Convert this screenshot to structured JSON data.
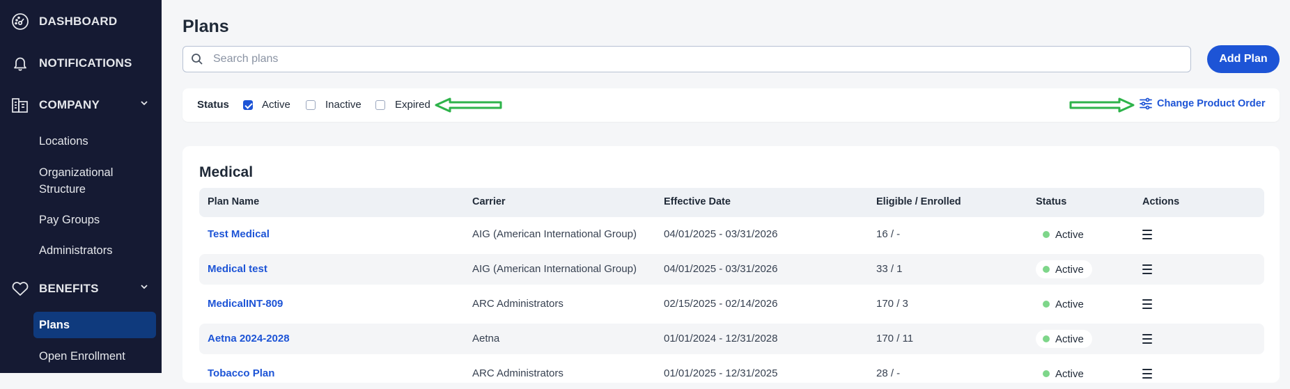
{
  "sidebar": {
    "dashboard": "DASHBOARD",
    "notifications": "NOTIFICATIONS",
    "company": "COMPANY",
    "company_items": [
      "Locations",
      "Organizational",
      "Structure",
      "Pay Groups",
      "Administrators"
    ],
    "benefits": "BENEFITS",
    "benefits_items": [
      "Plans",
      "Open Enrollment"
    ]
  },
  "main": {
    "title": "Plans",
    "search_placeholder": "Search plans",
    "add_button": "Add Plan",
    "filters": {
      "label": "Status",
      "options": [
        {
          "label": "Active",
          "checked": true
        },
        {
          "label": "Inactive",
          "checked": false
        },
        {
          "label": "Expired",
          "checked": false
        }
      ],
      "change_order": "Change Product Order"
    },
    "section_title": "Medical",
    "columns": [
      "Plan Name",
      "Carrier",
      "Effective Date",
      "Eligible / Enrolled",
      "Status",
      "Actions"
    ],
    "rows": [
      {
        "plan": "Test Medical",
        "carrier": "AIG (American International Group)",
        "date": "04/01/2025 - 03/31/2026",
        "elig": "16 / -",
        "status": "Active"
      },
      {
        "plan": "Medical test",
        "carrier": "AIG (American International Group)",
        "date": "04/01/2025 - 03/31/2026",
        "elig": "33 / 1",
        "status": "Active"
      },
      {
        "plan": "MedicalINT-809",
        "carrier": "ARC Administrators",
        "date": "02/15/2025 - 02/14/2026",
        "elig": "170 / 3",
        "status": "Active"
      },
      {
        "plan": "Aetna 2024-2028",
        "carrier": "Aetna",
        "date": "01/01/2024 - 12/31/2028",
        "elig": "170 / 11",
        "status": "Active"
      },
      {
        "plan": "Tobacco Plan",
        "carrier": "ARC Administrators",
        "date": "01/01/2025 - 12/31/2025",
        "elig": "28 / -",
        "status": "Active"
      }
    ]
  },
  "colors": {
    "sidebar_bg": "#151a33",
    "active_nav": "#0f3a7d",
    "accent": "#1d54d6",
    "status_dot": "#7ed68a",
    "annotation_arrow": "#2eb34a"
  }
}
